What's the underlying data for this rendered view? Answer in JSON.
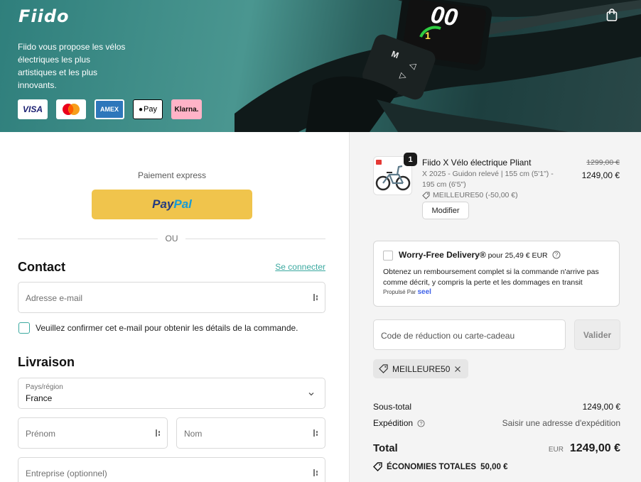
{
  "header": {
    "logo": "Fiido",
    "tagline": "Fiido vous propose les vélos électriques les plus artistiques et les plus innovants.",
    "payment_methods": [
      "VISA",
      "Mastercard",
      "AMEX",
      "Pay",
      "Klarna."
    ],
    "display_speed": "00",
    "display_level": "1",
    "display_buttons": [
      "M",
      "◁",
      "▷"
    ]
  },
  "express": {
    "title": "Paiement express",
    "paypal_pay": "Pay",
    "paypal_pal": "Pal",
    "divider": "OU"
  },
  "contact": {
    "heading": "Contact",
    "login_link": "Se connecter",
    "email_placeholder": "Adresse e-mail",
    "confirm_label": "Veuillez confirmer cet e-mail pour obtenir les détails de la commande."
  },
  "delivery": {
    "heading": "Livraison",
    "country_label": "Pays/région",
    "country_value": "France",
    "first_name_placeholder": "Prénom",
    "last_name_placeholder": "Nom",
    "company_placeholder": "Entreprise (optionnel)"
  },
  "cart": {
    "quantity": "1",
    "product_name": "Fiido X Vélo électrique Pliant",
    "variant": "X 2025 - Guidon relevé | 155 cm (5'1\") - 195 cm (6'5\")",
    "discount_line": "MEILLEURE50 (-50,00 €)",
    "modify_label": "Modifier",
    "old_price": "1299,00 €",
    "new_price": "1249,00 €"
  },
  "worry_free": {
    "title": "Worry-Free Delivery®",
    "price": " pour 25,49 € EUR",
    "body": "Obtenez un remboursement complet si la commande n'arrive pas comme décrit, y compris la perte et les dommages en transit",
    "powered_by": "Propulsé Par",
    "brand": "seel"
  },
  "discount": {
    "placeholder": "Code de réduction ou carte-cadeau",
    "apply_label": "Valider",
    "applied_code": "MEILLEURE50"
  },
  "summary": {
    "subtotal_label": "Sous-total",
    "subtotal_value": "1249,00 €",
    "shipping_label": "Expédition",
    "shipping_value": "Saisir une adresse d'expédition",
    "total_label": "Total",
    "currency": "EUR",
    "total_value": "1249,00 €",
    "savings_label": "ÉCONOMIES TOTALES",
    "savings_value": "50,00 €"
  }
}
